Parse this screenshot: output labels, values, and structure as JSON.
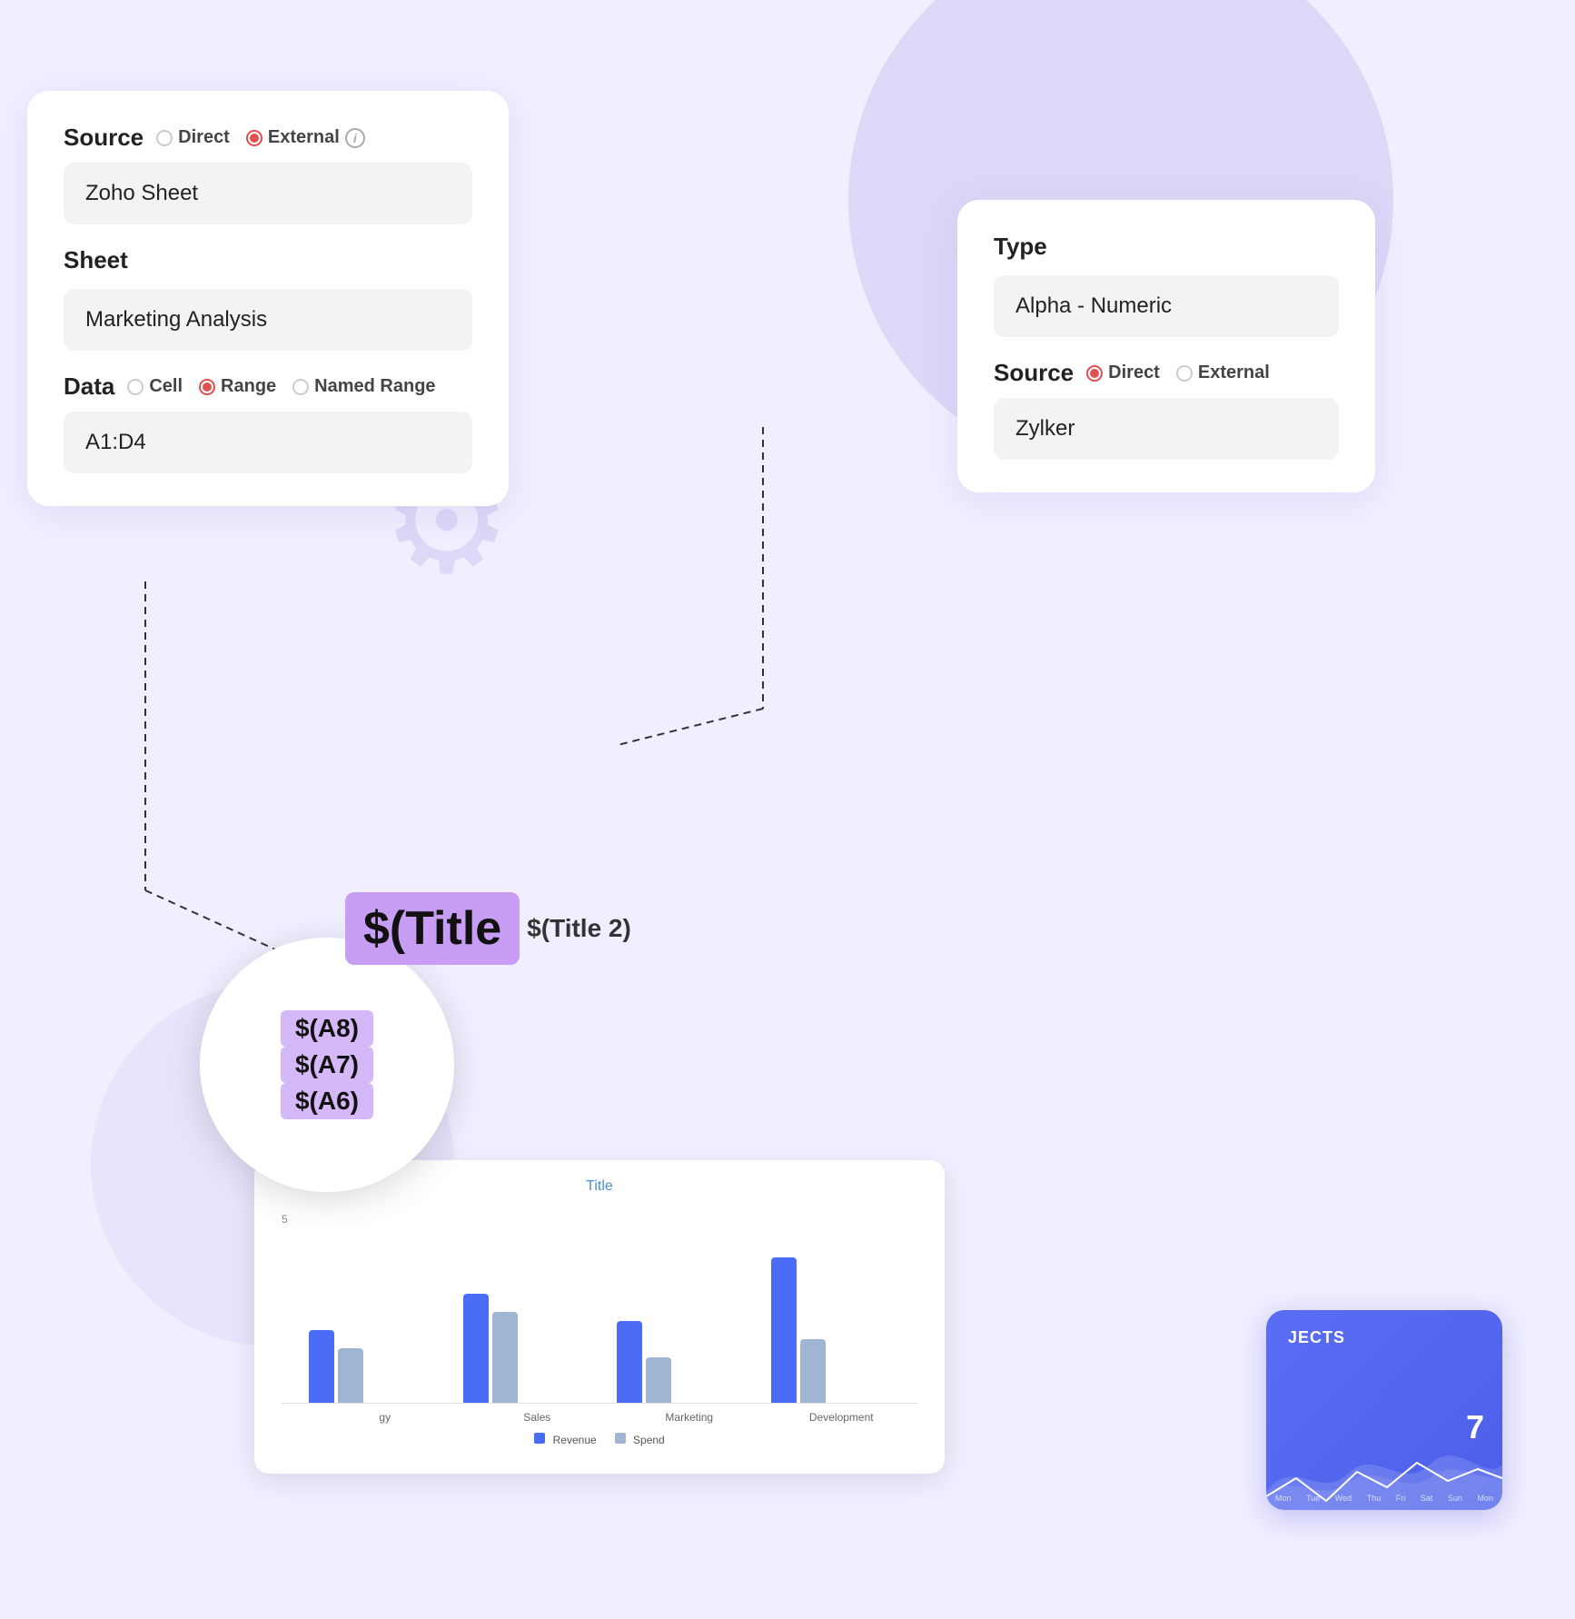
{
  "background": {
    "color": "#f0eeff"
  },
  "source_card": {
    "source_label": "Source",
    "direct_label": "Direct",
    "external_label": "External",
    "direct_selected": false,
    "external_selected": true,
    "zoho_sheet_label": "Sheet",
    "zoho_sheet_value": "Zoho Sheet",
    "sheet_label": "Sheet",
    "sheet_value": "Marketing Analysis",
    "data_label": "Data",
    "cell_label": "Cell",
    "range_label": "Range",
    "named_range_label": "Named Range",
    "range_selected": true,
    "data_value": "A1:D4"
  },
  "type_card": {
    "type_label": "Type",
    "type_value": "Alpha - Numeric",
    "source_label": "Source",
    "direct_label": "Direct",
    "external_label": "External",
    "direct_selected": true,
    "external_selected": false,
    "source_value": "Zylker"
  },
  "formula_zoom": {
    "items": [
      "$(A8)",
      "$(A7)",
      "$(A6)"
    ]
  },
  "title_bubble": {
    "large_text": "$(Title",
    "small_text": "$(Title 2)"
  },
  "chart": {
    "title": "Title",
    "y_label": "5",
    "groups": [
      {
        "label": "gy",
        "revenue_height": 80,
        "spend_height": 60
      },
      {
        "label": "Sales",
        "revenue_height": 120,
        "spend_height": 100
      },
      {
        "label": "Marketing",
        "revenue_height": 90,
        "spend_height": 50
      },
      {
        "label": "Development",
        "revenue_height": 160,
        "spend_height": 70
      }
    ],
    "legend_revenue": "Revenue",
    "legend_spend": "Spend"
  },
  "projects_card": {
    "title": "JECTS",
    "number": "7",
    "wave_days": [
      "Mon",
      "Tue",
      "Wed",
      "Thu",
      "Fri",
      "Sat",
      "Sun",
      "Mon"
    ]
  }
}
